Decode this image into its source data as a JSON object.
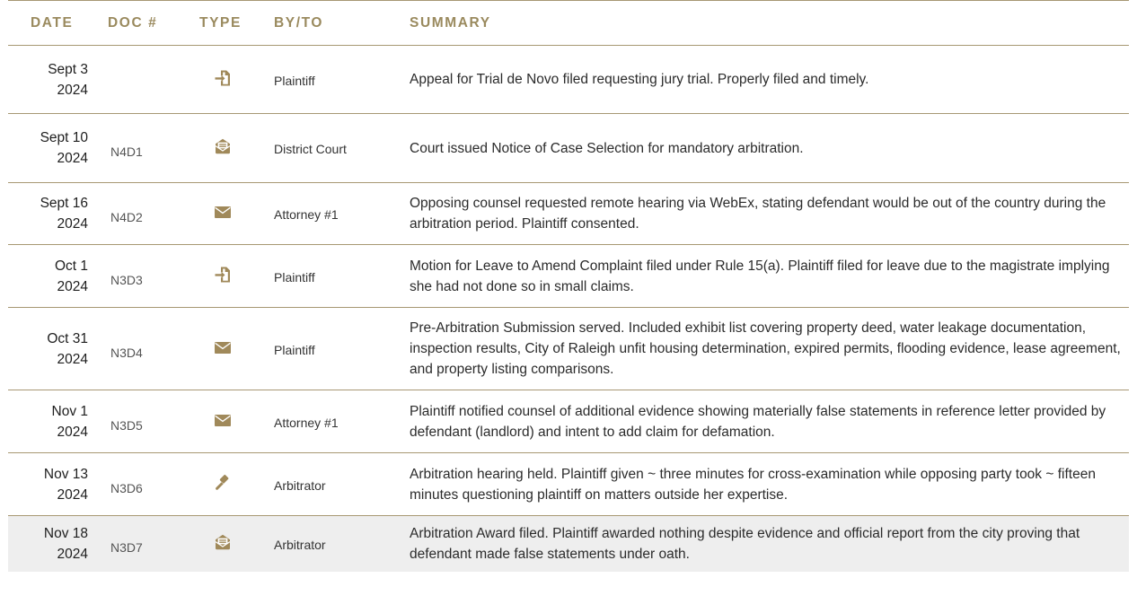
{
  "headers": {
    "date": "DATE",
    "doc": "DOC #",
    "type": "TYPE",
    "by": "BY/TO",
    "summary": "SUMMARY"
  },
  "accent_color": "#a0895a",
  "rows": [
    {
      "date_line1": "Sept 3",
      "date_line2": "2024",
      "doc": "",
      "type_icon": "file-import-icon",
      "by": "Plaintiff",
      "summary": "Appeal for Trial de Novo filed requesting jury trial. Properly filed and timely."
    },
    {
      "date_line1": "Sept 10",
      "date_line2": "2024",
      "doc": "N4D1",
      "type_icon": "envelope-open-text-icon",
      "by": "District Court",
      "summary": "Court issued Notice of Case Selection for mandatory arbitration."
    },
    {
      "date_line1": "Sept 16",
      "date_line2": "2024",
      "doc": "N4D2",
      "type_icon": "envelope-icon",
      "by": "Attorney #1",
      "summary": "Opposing counsel requested remote hearing via WebEx, stating defendant would be out of the country during the arbitration period. Plaintiff consented."
    },
    {
      "date_line1": "Oct 1",
      "date_line2": "2024",
      "doc": "N3D3",
      "type_icon": "file-import-icon",
      "by": "Plaintiff",
      "summary": "Motion for Leave to Amend Complaint filed under Rule 15(a). Plaintiff filed for leave due to the magistrate implying she had not done so in small claims."
    },
    {
      "date_line1": "Oct 31",
      "date_line2": "2024",
      "doc": "N3D4",
      "type_icon": "envelope-icon",
      "by": "Plaintiff",
      "summary": "Pre-Arbitration Submission served. Included exhibit list covering property deed, water leakage documentation, inspection results, City of Raleigh unfit housing determination, expired permits, flooding evidence, lease agreement, and property listing comparisons."
    },
    {
      "date_line1": "Nov 1",
      "date_line2": "2024",
      "doc": "N3D5",
      "type_icon": "envelope-icon",
      "by": "Attorney #1",
      "summary": "Plaintiff notified counsel of additional evidence showing materially false statements in reference letter provided by defendant (landlord) and intent to add claim for defamation."
    },
    {
      "date_line1": "Nov 13",
      "date_line2": "2024",
      "doc": "N3D6",
      "type_icon": "gavel-icon",
      "by": "Arbitrator",
      "summary": "Arbitration hearing held. Plaintiff given ~ three minutes for cross-examination while opposing party took ~ fifteen minutes questioning plaintiff on matters outside her expertise."
    },
    {
      "date_line1": "Nov 18",
      "date_line2": "2024",
      "doc": "N3D7",
      "type_icon": "envelope-open-text-icon",
      "by": "Arbitrator",
      "summary": "Arbitration Award filed. Plaintiff awarded nothing despite evidence and official report from the city proving that defendant made false statements under oath."
    }
  ]
}
